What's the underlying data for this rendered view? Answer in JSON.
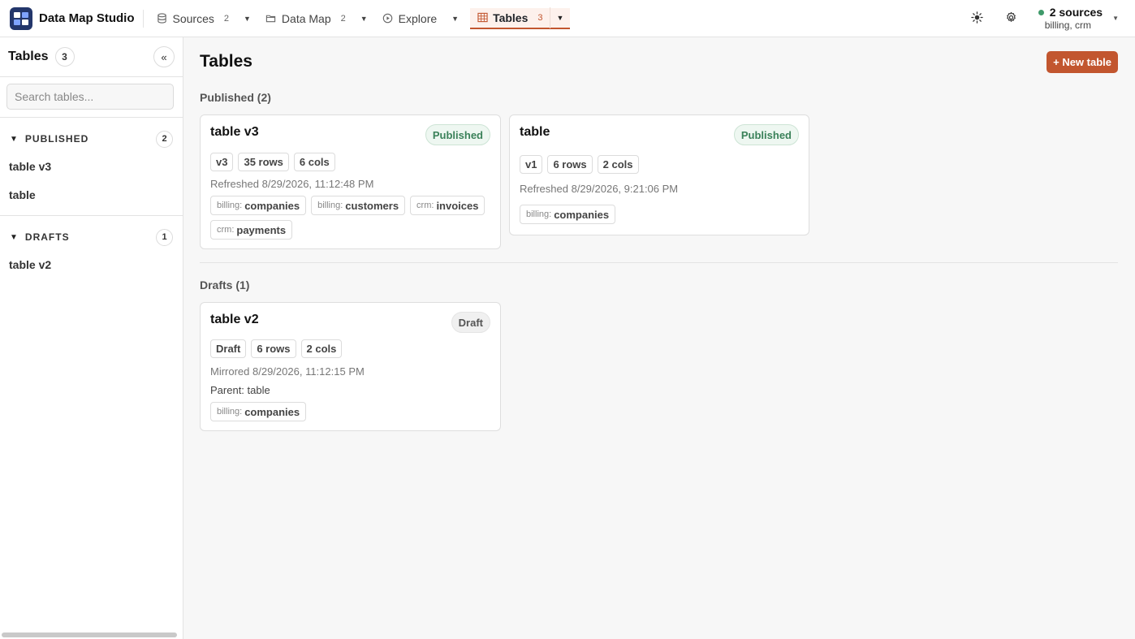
{
  "app": {
    "name": "Data Map Studio"
  },
  "nav": [
    {
      "label": "Sources",
      "count": "2",
      "icon": "database-icon"
    },
    {
      "label": "Data Map",
      "count": "2",
      "icon": "folder-icon"
    },
    {
      "label": "Explore",
      "count": "",
      "icon": "compass-icon"
    },
    {
      "label": "Tables",
      "count": "3",
      "icon": "table-icon",
      "active": true
    }
  ],
  "topright": {
    "sources_label": "2 sources",
    "sources_list": "billing, crm",
    "status_color": "#3f9a6a"
  },
  "sidebar": {
    "title": "Tables",
    "count": "3",
    "collapse_label": "«",
    "search_placeholder": "Search tables...",
    "groups": [
      {
        "label": "PUBLISHED",
        "count": "2",
        "items": [
          "table v3",
          "table"
        ]
      },
      {
        "label": "DRAFTS",
        "count": "1",
        "items": [
          "table v2"
        ]
      }
    ]
  },
  "main": {
    "title": "Tables",
    "new_button": "+ New table",
    "published_title": "Published (2)",
    "drafts_title": "Drafts (1)",
    "published_cards": [
      {
        "title": "table v3",
        "status": "Published",
        "chips": [
          "v3",
          "35 rows",
          "6 cols"
        ],
        "meta": "Refreshed 8/29/2026, 11:12:48 PM",
        "sources": [
          {
            "prefix": "billing:",
            "name": "companies"
          },
          {
            "prefix": "billing:",
            "name": "customers"
          },
          {
            "prefix": "crm:",
            "name": "invoices"
          },
          {
            "prefix": "crm:",
            "name": "payments"
          }
        ]
      },
      {
        "title": "table",
        "status": "Published",
        "chips": [
          "v1",
          "6 rows",
          "2 cols"
        ],
        "meta": "Refreshed 8/29/2026, 9:21:06 PM",
        "sources": [
          {
            "prefix": "billing:",
            "name": "companies"
          }
        ]
      }
    ],
    "draft_cards": [
      {
        "title": "table v2",
        "status": "Draft",
        "chips": [
          "Draft",
          "6 rows",
          "2 cols"
        ],
        "meta": "Mirrored 8/29/2026, 11:12:15 PM",
        "parent": "Parent: table",
        "sources": [
          {
            "prefix": "billing:",
            "name": "companies"
          }
        ]
      }
    ]
  },
  "colors": {
    "accent": "#c2562f",
    "published": "#3a8159"
  }
}
